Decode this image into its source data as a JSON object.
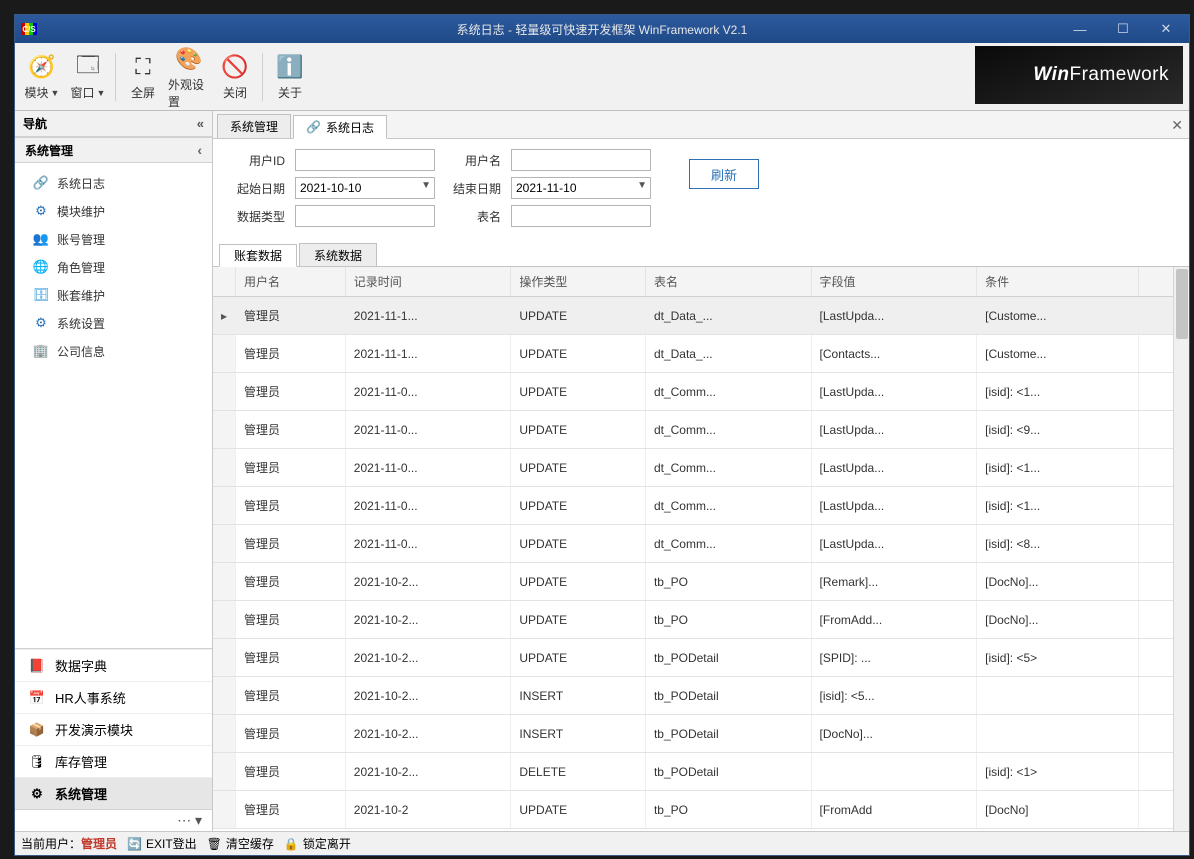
{
  "window": {
    "title": "系统日志 - 轻量级可快速开发框架 WinFramework V2.1",
    "icon_label": "C/S"
  },
  "titlebar_buttons": {
    "min": "—",
    "max": "☐",
    "close": "✕"
  },
  "ribbon": {
    "items": [
      {
        "label": "模块",
        "dropdown": true,
        "icon": "🧭"
      },
      {
        "label": "窗口",
        "dropdown": true,
        "icon": "🗔"
      },
      {
        "label": "全屏",
        "dropdown": false,
        "icon": "⛶"
      },
      {
        "label": "外观设置",
        "dropdown": false,
        "icon": "🎨"
      },
      {
        "label": "关闭",
        "dropdown": false,
        "icon": "🚫"
      },
      {
        "label": "关于",
        "dropdown": false,
        "icon": "ℹ️"
      }
    ],
    "brand_prefix": "Win",
    "brand_suffix": "Framework"
  },
  "nav": {
    "header": "导航",
    "group_header": "系统管理",
    "items": [
      {
        "label": "系统日志",
        "icon": "🔗",
        "color": "#e04848"
      },
      {
        "label": "模块维护",
        "icon": "⚙",
        "color": "#2a6fb8"
      },
      {
        "label": "账号管理",
        "icon": "👥",
        "color": "#2a88c8"
      },
      {
        "label": "角色管理",
        "icon": "🌐",
        "color": "#1f8fd8"
      },
      {
        "label": "账套维护",
        "icon": "🗄",
        "color": "#1f8fd8"
      },
      {
        "label": "系统设置",
        "icon": "⚙",
        "color": "#2a6fb8"
      },
      {
        "label": "公司信息",
        "icon": "🏢",
        "color": "#1f8fd8"
      }
    ],
    "bottom_modules": [
      {
        "label": "数据字典",
        "icon": "📕"
      },
      {
        "label": "HR人事系统",
        "icon": "📅"
      },
      {
        "label": "开发演示模块",
        "icon": "📦"
      },
      {
        "label": "库存管理",
        "icon": "🛢"
      },
      {
        "label": "系统管理",
        "icon": "⚙",
        "active": true
      }
    ]
  },
  "doc_tabs": [
    {
      "label": "系统管理",
      "active": false
    },
    {
      "label": "系统日志",
      "active": true,
      "icon": "🔗"
    }
  ],
  "filters": {
    "labels": {
      "user_id": "用户ID",
      "user_name": "用户名",
      "start_date": "起始日期",
      "end_date": "结束日期",
      "data_type": "数据类型",
      "table_name": "表名"
    },
    "values": {
      "user_id": "",
      "user_name": "",
      "start_date": "2021-10-10",
      "end_date": "2021-11-10",
      "data_type": "",
      "table_name": ""
    },
    "refresh": "刷新"
  },
  "sub_tabs": [
    {
      "label": "账套数据",
      "active": true
    },
    {
      "label": "系统数据",
      "active": false
    }
  ],
  "grid": {
    "columns": [
      "用户名",
      "记录时间",
      "操作类型",
      "表名",
      "字段值",
      "条件"
    ],
    "rows": [
      {
        "c": [
          "管理员",
          "2021-11-1...",
          "UPDATE",
          "dt_Data_...",
          "[LastUpda...",
          "[Custome..."
        ],
        "selected": true
      },
      {
        "c": [
          "管理员",
          "2021-11-1...",
          "UPDATE",
          "dt_Data_...",
          "[Contacts...",
          "[Custome..."
        ]
      },
      {
        "c": [
          "管理员",
          "2021-11-0...",
          "UPDATE",
          "dt_Comm...",
          "[LastUpda...",
          "[isid]: <1..."
        ]
      },
      {
        "c": [
          "管理员",
          "2021-11-0...",
          "UPDATE",
          "dt_Comm...",
          "[LastUpda...",
          "[isid]: <9..."
        ]
      },
      {
        "c": [
          "管理员",
          "2021-11-0...",
          "UPDATE",
          "dt_Comm...",
          "[LastUpda...",
          "[isid]: <1..."
        ]
      },
      {
        "c": [
          "管理员",
          "2021-11-0...",
          "UPDATE",
          "dt_Comm...",
          "[LastUpda...",
          "[isid]: <1..."
        ]
      },
      {
        "c": [
          "管理员",
          "2021-11-0...",
          "UPDATE",
          "dt_Comm...",
          "[LastUpda...",
          "[isid]: <8..."
        ]
      },
      {
        "c": [
          "管理员",
          "2021-10-2...",
          "UPDATE",
          "tb_PO",
          "[Remark]...",
          "[DocNo]..."
        ]
      },
      {
        "c": [
          "管理员",
          "2021-10-2...",
          "UPDATE",
          "tb_PO",
          "[FromAdd...",
          "[DocNo]..."
        ]
      },
      {
        "c": [
          "管理员",
          "2021-10-2...",
          "UPDATE",
          "tb_PODetail",
          "[SPID]: ...",
          "[isid]: <5>"
        ]
      },
      {
        "c": [
          "管理员",
          "2021-10-2...",
          "INSERT",
          "tb_PODetail",
          "[isid]: <5...",
          ""
        ]
      },
      {
        "c": [
          "管理员",
          "2021-10-2...",
          "INSERT",
          "tb_PODetail",
          "[DocNo]...",
          ""
        ]
      },
      {
        "c": [
          "管理员",
          "2021-10-2...",
          "DELETE",
          "tb_PODetail",
          "",
          "[isid]: <1>"
        ]
      },
      {
        "c": [
          "管理员",
          "2021-10-2",
          "UPDATE",
          "tb_PO",
          "[FromAdd",
          "[DocNo]"
        ]
      }
    ]
  },
  "statusbar": {
    "current_user_label": "当前用户：",
    "current_user": "管理员",
    "exit": "EXIT登出",
    "clear_cache": "清空缓存",
    "lock": "锁定离开"
  }
}
